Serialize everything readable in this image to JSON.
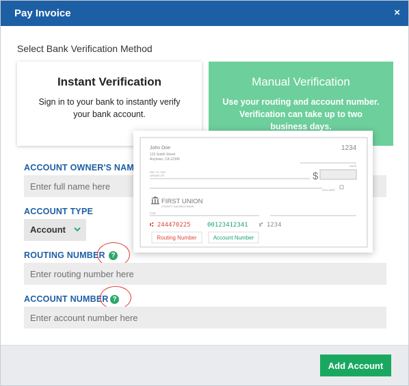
{
  "dialog": {
    "title": "Pay Invoice",
    "close_glyph": "×"
  },
  "method": {
    "label": "Select Bank Verification Method",
    "instant": {
      "title": "Instant Verification",
      "description": "Sign in to your bank to instantly verify your bank account."
    },
    "manual": {
      "title": "Manual Verification",
      "description": "Use your routing and account number. Verification can take up to two business days."
    }
  },
  "fields": {
    "owner_label": "ACCOUNT OWNER'S NAME",
    "owner_placeholder": "Enter full name here",
    "type_label": "ACCOUNT TYPE",
    "type_value": "Account",
    "routing_label": "ROUTING NUMBER",
    "routing_placeholder": "Enter routing number here",
    "account_label": "ACCOUNT NUMBER",
    "account_placeholder": "Enter account number here",
    "help_glyph": "?"
  },
  "check": {
    "name": "John Doe",
    "address_line1": "123 Smith Street",
    "address_line2": "Anytown, CA 12345",
    "check_number": "1234",
    "date_label": "DATE",
    "pay_label_1": "PAY TO THE",
    "pay_label_2": "ORDER OF",
    "currency_symbol": "$",
    "dollars_label": "DOLLARS",
    "bank_name": "FIRST UNION",
    "bank_subtitle": "COUNTY SAVINGS BANK",
    "for_label": "FOR",
    "micr_routing": "⑆ 244470225",
    "micr_account": "00123412341",
    "micr_check": "⑈ 1234",
    "routing_tag": "Routing Number",
    "account_tag": "Account Number"
  },
  "footer": {
    "add_account_label": "Add Account"
  },
  "colors": {
    "header_blue": "#1d5fa4",
    "manual_green": "#6dcf9c",
    "button_green": "#1aa860",
    "help_green": "#2aa86a",
    "annotation_red": "#e53935",
    "routing_red": "#e0443a",
    "account_teal": "#1aa27a"
  },
  "icons": {
    "close": "close-icon",
    "chevron": "chevron-down-icon",
    "help": "help-icon",
    "bank": "bank-icon",
    "lock": "lock-icon"
  }
}
